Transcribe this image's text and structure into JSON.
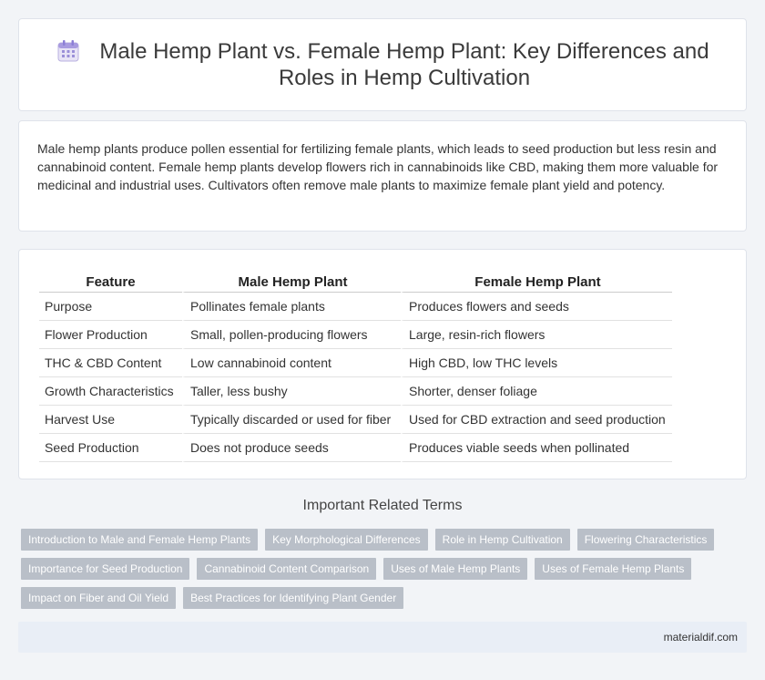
{
  "header": {
    "title": "Male Hemp Plant vs. Female Hemp Plant: Key Differences and Roles in Hemp Cultivation",
    "icon": "calendar-icon"
  },
  "intro": {
    "text": "Male hemp plants produce pollen essential for fertilizing female plants, which leads to seed production but less resin and cannabinoid content. Female hemp plants develop flowers rich in cannabinoids like CBD, making them more valuable for medicinal and industrial uses. Cultivators often remove male plants to maximize female plant yield and potency."
  },
  "table": {
    "headers": [
      "Feature",
      "Male Hemp Plant",
      "Female Hemp Plant"
    ],
    "rows": [
      [
        "Purpose",
        "Pollinates female plants",
        "Produces flowers and seeds"
      ],
      [
        "Flower Production",
        "Small, pollen-producing flowers",
        "Large, resin-rich flowers"
      ],
      [
        "THC & CBD Content",
        "Low cannabinoid content",
        "High CBD, low THC levels"
      ],
      [
        "Growth Characteristics",
        "Taller, less bushy",
        "Shorter, denser foliage"
      ],
      [
        "Harvest Use",
        "Typically discarded or used for fiber",
        "Used for CBD extraction and seed production"
      ],
      [
        "Seed Production",
        "Does not produce seeds",
        "Produces viable seeds when pollinated"
      ]
    ]
  },
  "related": {
    "title": "Important Related Terms",
    "tags": [
      "Introduction to Male and Female Hemp Plants",
      "Key Morphological Differences",
      "Role in Hemp Cultivation",
      "Flowering Characteristics",
      "Importance for Seed Production",
      "Cannabinoid Content Comparison",
      "Uses of Male Hemp Plants",
      "Uses of Female Hemp Plants",
      "Impact on Fiber and Oil Yield",
      "Best Practices for Identifying Plant Gender"
    ]
  },
  "footer": {
    "site": "materialdif.com"
  }
}
